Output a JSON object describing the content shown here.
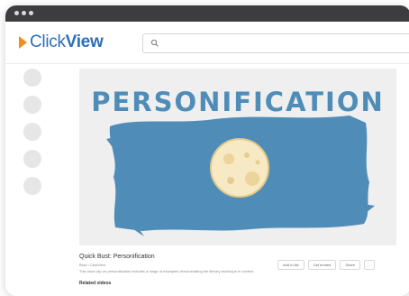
{
  "window": {
    "controls": [
      "close",
      "minimize",
      "maximize"
    ]
  },
  "header": {
    "logo_part1": "Click",
    "logo_part2": "View",
    "search": {
      "placeholder": "",
      "icon": "search-icon"
    }
  },
  "sidebar": {
    "items": [
      {
        "icon": "nav-icon"
      },
      {
        "icon": "nav-icon"
      },
      {
        "icon": "nav-icon"
      },
      {
        "icon": "nav-icon"
      },
      {
        "icon": "nav-icon"
      }
    ]
  },
  "video": {
    "thumbnail_text": "PERSONIFICATION",
    "title": "Quick Bust: Personification",
    "meta": "Beta • ClickView",
    "description": "This short clip on personification includes a range of examples demonstrating the literary technique in context.",
    "actions": [
      "Add to list",
      "Get embed",
      "Share"
    ],
    "more": "…"
  },
  "related_heading": "Related videos",
  "colors": {
    "accent_orange": "#f28c1e",
    "brand_blue": "#2d6fb7",
    "paint_blue": "#4f8db8"
  }
}
